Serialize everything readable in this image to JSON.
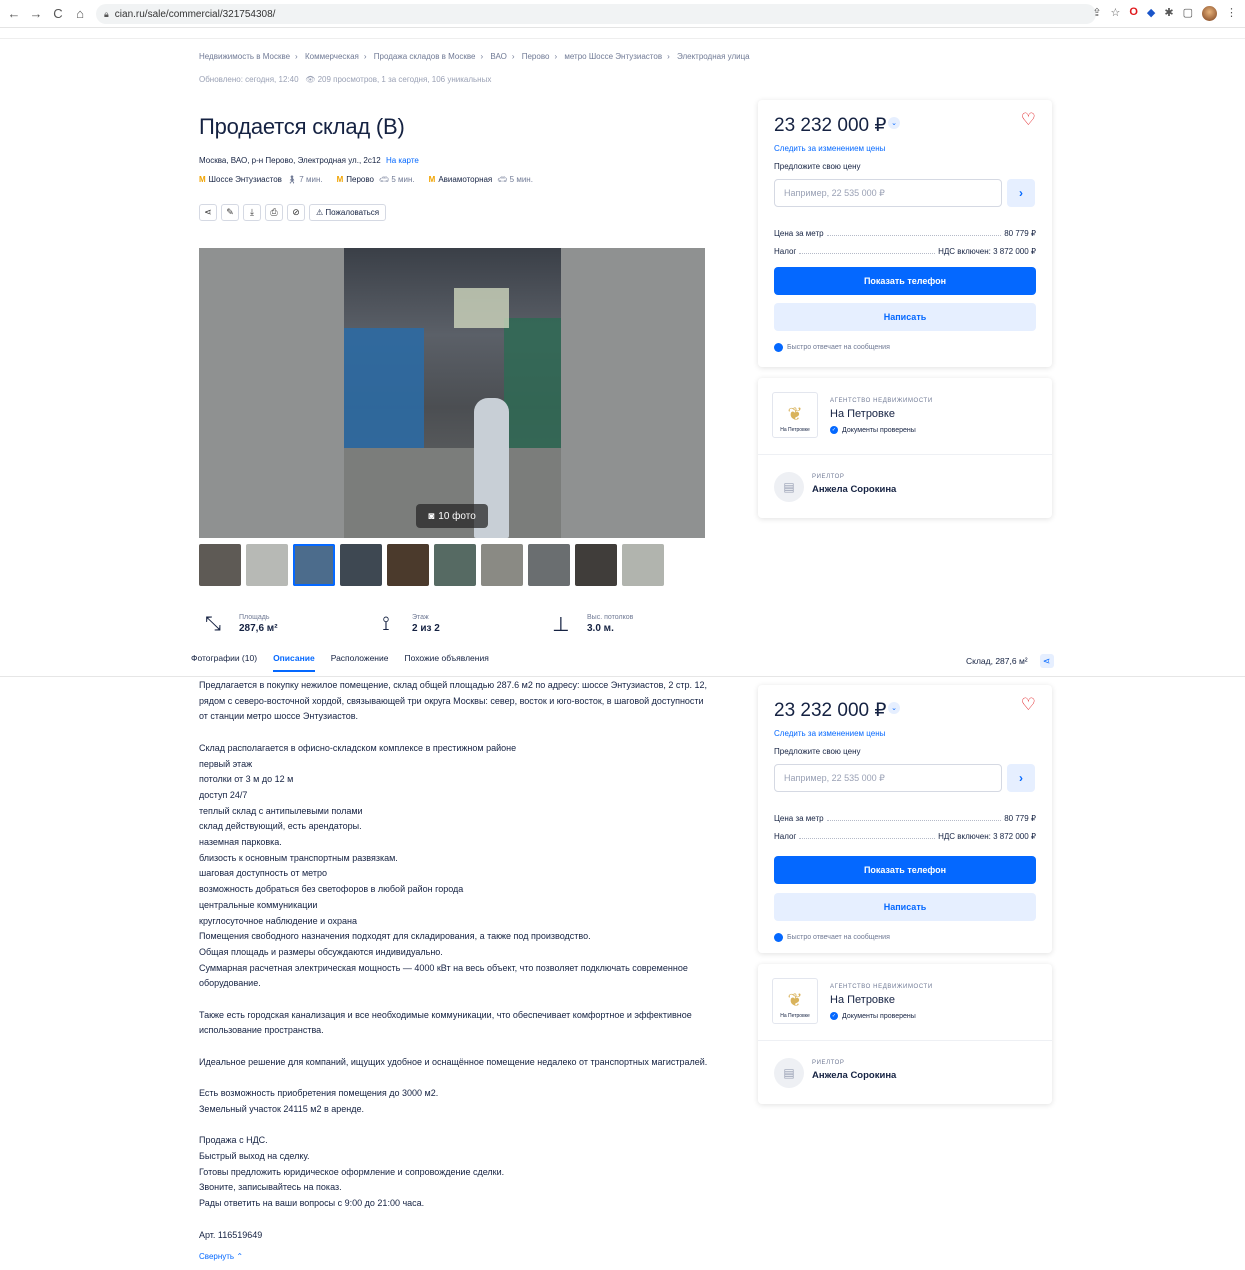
{
  "browser": {
    "url": "cian.ru/sale/commercial/321754308/"
  },
  "breadcrumbs": [
    "Недвижимость в Москве",
    "Коммерческая",
    "Продажа складов в Москве",
    "ВАО",
    "Перово",
    "метро Шоссе Энтузиастов",
    "Электродная улица"
  ],
  "updated": "Обновлено: сегодня, 12:40",
  "views": "209 просмотров, 1 за сегодня, 106 уникальных",
  "title": "Продается склад (B)",
  "address": "Москва, ВАО, р-н Перово, Электродная ул., 2с12",
  "map_link": "На карте",
  "metro": [
    {
      "name": "Шоссе Энтузиастов",
      "time": "7 мин.",
      "mode": "walk"
    },
    {
      "name": "Перово",
      "time": "5 мин.",
      "mode": "car"
    },
    {
      "name": "Авиамоторная",
      "time": "5 мин.",
      "mode": "car"
    }
  ],
  "complain_label": "Пожаловаться",
  "photo_count": "10 фото",
  "features": [
    {
      "label": "Площадь",
      "value": "287,6 м²"
    },
    {
      "label": "Этаж",
      "value": "2 из 2"
    },
    {
      "label": "Выс. потолков",
      "value": "3.0 м."
    }
  ],
  "tabs": [
    "Фотографии (10)",
    "Описание",
    "Расположение",
    "Похожие объявления"
  ],
  "tab_right": "Склад, 287,6 м²",
  "price_card": {
    "price": "23 232 000 ₽",
    "follow": "Следить за изменением цены",
    "offer_label": "Предложите свою цену",
    "offer_placeholder": "Например, 22 535 000 ₽",
    "per_meter_label": "Цена за метр",
    "per_meter_value": "80 779 ₽",
    "tax_label": "Налог",
    "tax_value": "НДС включен: 3 872 000 ₽",
    "phone_button": "Показать телефон",
    "write_button": "Написать",
    "fast_reply": "Быстро отвечает на сообщения"
  },
  "agent": {
    "type": "АГЕНТСТВО НЕДВИЖИМОСТИ",
    "name": "На Петровке",
    "logo_text": "На Петровке",
    "verified": "Документы проверены",
    "realtor_type": "РИЕЛТОР",
    "realtor_name": "Анжела Сорокина"
  },
  "description": [
    "Предлагается в покупку нежилое помещение, склад общей площадью 287.6 м2 по адресу: шоссе Энтузиастов, 2 стр. 12, рядом с северо-восточной хордой, связывающей три округа Москвы: север, восток и юго-восток, в шаговой доступности от станции метро шоссе Энтузиастов.",
    "",
    "Склад располагается в офисно-складском комплексе в престижном районе\nпервый этаж\nпотолки от 3 м до 12 м\nдоступ 24/7\nтеплый склад с антипылевыми полами\nсклад действующий, есть арендаторы.\nназемная парковка.\nблизость к основным транспортным развязкам.\nшаговая доступность от метро\nвозможность добраться без светофоров в любой район города\nцентральные коммуникации\nкруглосуточное наблюдение и охрана\nПомещения свободного назначения подходят для складирования, а также под производство.\nОбщая площадь и размеры обсуждаются индивидуально.\nСуммарная расчетная электрическая мощность — 4000 кВт на весь объект, что позволяет подключать современное оборудование.",
    "",
    "Также есть городская канализация и все необходимые коммуникации, что обеспечивает комфортное и эффективное использование пространства.",
    "",
    "Идеальное решение для компаний, ищущих удобное и оснащённое помещение недалеко от транспортных магистралей.",
    "",
    "Есть возможность приобретения помещения до 3000 м2.\nЗемельный участок 24115 м2 в аренде.",
    "",
    "Продажа с НДС.\nБыстрый выход на сделку.\nГотовы предложить юридическое оформление и сопровождение сделки.\nЗвоните, записывайтесь на показ.\nРады ответить на ваши вопросы с 9:00 до 21:00 часа.",
    "",
    "Арт. 116519649"
  ],
  "collapse": "Свернуть"
}
